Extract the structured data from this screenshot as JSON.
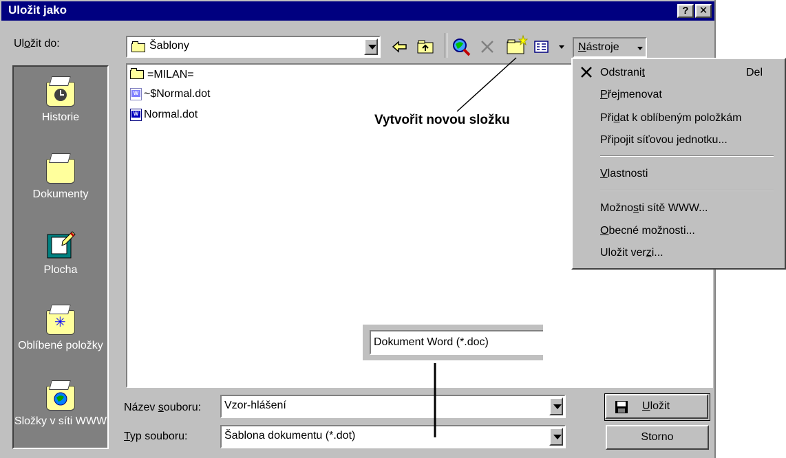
{
  "window": {
    "title": "Uložit jako",
    "help_label": "?",
    "close_label": "✕"
  },
  "save_in": {
    "label_pre": "Ul",
    "label_key": "o",
    "label_post": "žit do:",
    "value": "Šablony"
  },
  "toolbar": {
    "tools_label_key": "N",
    "tools_label_rest": "ástroje"
  },
  "places": [
    {
      "label": "Historie",
      "icon": "history-folder-icon"
    },
    {
      "label": "Dokumenty",
      "icon": "documents-folder-icon"
    },
    {
      "label": "Plocha",
      "icon": "desktop-icon"
    },
    {
      "label": "Oblíbené položky",
      "icon": "favorites-folder-icon"
    },
    {
      "label": "Složky v síti WWW",
      "icon": "web-folders-icon"
    }
  ],
  "files": [
    {
      "name": "=MILAN=",
      "type": "folder"
    },
    {
      "name": "~$Normal.dot",
      "type": "word-temp"
    },
    {
      "name": "Normal.dot",
      "type": "word"
    }
  ],
  "annotations": {
    "new_folder": "Vytvořit novou složku",
    "file_type_callout": "Dokument Word (*.doc)"
  },
  "filename": {
    "label_pre": "Název ",
    "label_key": "s",
    "label_post": "ouboru:",
    "value": "Vzor-hlášení"
  },
  "filetype": {
    "label_key": "T",
    "label_post": "yp souboru:",
    "value": "Šablona dokumentu (*.dot)"
  },
  "buttons": {
    "save_key": "U",
    "save_rest": "ložit",
    "cancel": "Storno"
  },
  "menu": {
    "delete": {
      "pre": "Odstrani",
      "key": "t",
      "post": "",
      "shortcut": "Del"
    },
    "rename": {
      "pre": "",
      "key": "P",
      "post": "řejmenovat"
    },
    "add_fav": {
      "pre": "Při",
      "key": "d",
      "post": "at k oblíbeným položkám"
    },
    "map_drive": {
      "pre": "Připojit síťovou ",
      "key": "j",
      "post": "ednotku..."
    },
    "properties": {
      "pre": "",
      "key": "V",
      "post": "lastnosti"
    },
    "web_options": {
      "pre": "Možno",
      "key": "s",
      "post": "ti sítě WWW..."
    },
    "general_options": {
      "pre": "",
      "key": "O",
      "post": "becné možnosti..."
    },
    "save_version": {
      "pre": "Uložit ver",
      "key": "z",
      "post": "i..."
    }
  }
}
